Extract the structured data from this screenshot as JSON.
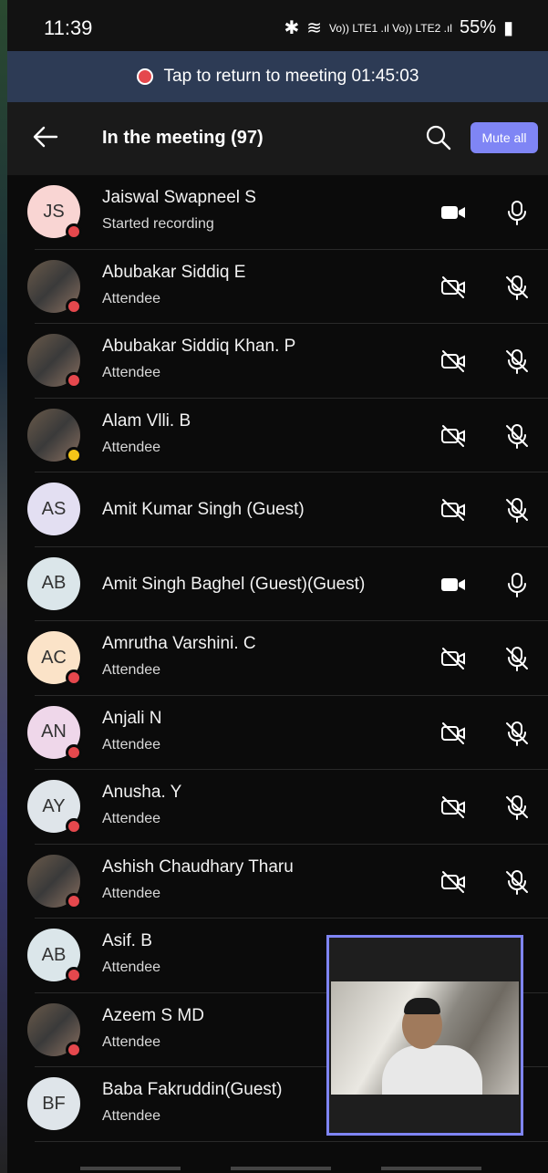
{
  "status_bar": {
    "time": "11:39",
    "bluetooth_icon": "bluetooth-icon",
    "signal_text": "Vo)) LTE1 .ıl Vo)) LTE2 .ıl",
    "battery": "55%"
  },
  "banner": {
    "text": "Tap to return to meeting 01:45:03",
    "dot_color": "#e5484d"
  },
  "header": {
    "title": "In the meeting (97)",
    "mute_all_label": "Mute all",
    "accent": "#7f85f5"
  },
  "participants": [
    {
      "initials": "JS",
      "name": "Jaiswal Swapneel S",
      "role": "Started recording",
      "avatar_color": "#f9d5d3",
      "photo": false,
      "presence": "busy",
      "camera": "on",
      "mic": "on"
    },
    {
      "initials": "",
      "name": "Abubakar Siddiq E",
      "role": "Attendee",
      "avatar_color": "",
      "photo": true,
      "presence": "busy",
      "camera": "off",
      "mic": "off"
    },
    {
      "initials": "",
      "name": "Abubakar Siddiq Khan. P",
      "role": "Attendee",
      "avatar_color": "",
      "photo": true,
      "presence": "busy",
      "camera": "off",
      "mic": "off"
    },
    {
      "initials": "",
      "name": "Alam Vlli. B",
      "role": "Attendee",
      "avatar_color": "",
      "photo": true,
      "presence": "away",
      "camera": "off",
      "mic": "off"
    },
    {
      "initials": "AS",
      "name": "Amit Kumar Singh (Guest)",
      "role": "",
      "avatar_color": "#e3dff2",
      "photo": false,
      "presence": "none",
      "camera": "off",
      "mic": "off"
    },
    {
      "initials": "AB",
      "name": "Amit Singh Baghel (Guest)(Guest)",
      "role": "",
      "avatar_color": "#dbe6ea",
      "photo": false,
      "presence": "none",
      "camera": "on",
      "mic": "on"
    },
    {
      "initials": "AC",
      "name": "Amrutha Varshini. C",
      "role": "Attendee",
      "avatar_color": "#fbe3c8",
      "photo": false,
      "presence": "busy",
      "camera": "off",
      "mic": "off"
    },
    {
      "initials": "AN",
      "name": "Anjali N",
      "role": "Attendee",
      "avatar_color": "#efd7ea",
      "photo": false,
      "presence": "busy",
      "camera": "off",
      "mic": "off"
    },
    {
      "initials": "AY",
      "name": "Anusha. Y",
      "role": "Attendee",
      "avatar_color": "#dfe5ea",
      "photo": false,
      "presence": "busy",
      "camera": "off",
      "mic": "off"
    },
    {
      "initials": "",
      "name": "Ashish Chaudhary Tharu",
      "role": "Attendee",
      "avatar_color": "",
      "photo": true,
      "presence": "busy",
      "camera": "off",
      "mic": "off"
    },
    {
      "initials": "AB",
      "name": "Asif. B",
      "role": "Attendee",
      "avatar_color": "#dbe6ea",
      "photo": false,
      "presence": "busy",
      "camera": "hidden",
      "mic": "hidden"
    },
    {
      "initials": "",
      "name": "Azeem S MD",
      "role": "Attendee",
      "avatar_color": "",
      "photo": true,
      "presence": "busy",
      "camera": "hidden",
      "mic": "hidden"
    },
    {
      "initials": "BF",
      "name": "Baba Fakruddin(Guest)",
      "role": "Attendee",
      "avatar_color": "#dfe5ea",
      "photo": false,
      "presence": "none",
      "camera": "hidden",
      "mic": "hidden"
    }
  ]
}
